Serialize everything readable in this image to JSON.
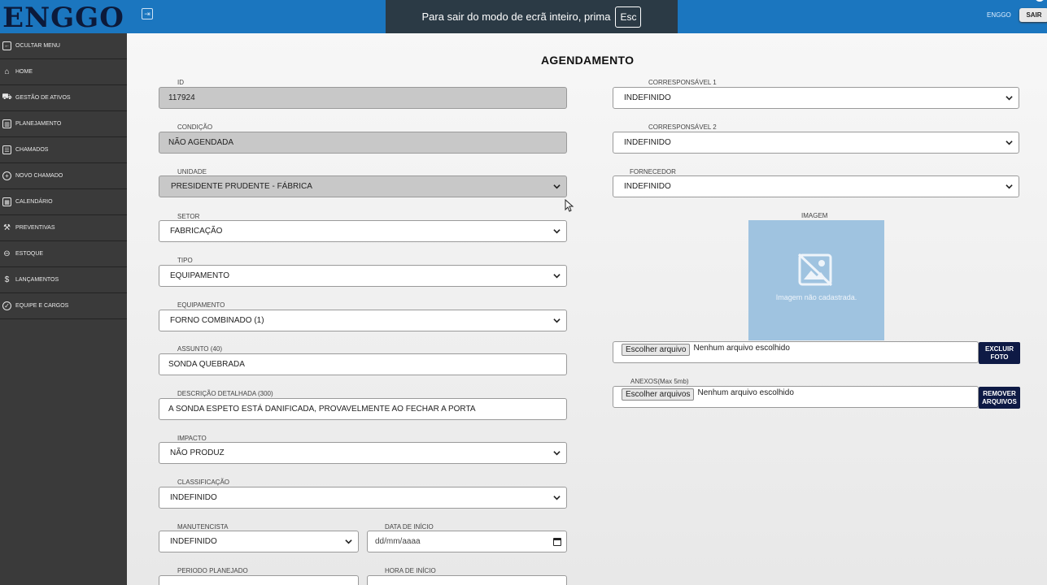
{
  "header": {
    "logo": "ENGGO",
    "fullscreen_banner": {
      "text": "Para sair do modo de ecrã inteiro, prima",
      "key": "Esc"
    },
    "user": "ENGGO",
    "logout_label": "SAIR"
  },
  "sidebar": {
    "items": [
      {
        "label": "OCULTAR MENU",
        "icon": "collapse-icon"
      },
      {
        "label": "HOME",
        "icon": "home-icon"
      },
      {
        "label": "GESTÃO DE ATIVOS",
        "icon": "truck-icon"
      },
      {
        "label": "PLANEJAMENTO",
        "icon": "columns-icon"
      },
      {
        "label": "CHAMADOS",
        "icon": "list-icon"
      },
      {
        "label": "NOVO CHAMADO",
        "icon": "plus-circle-icon"
      },
      {
        "label": "CALENDÁRIO",
        "icon": "calendar-icon"
      },
      {
        "label": "PREVENTIVAS",
        "icon": "tools-icon"
      },
      {
        "label": "ESTOQUE",
        "icon": "basket-icon"
      },
      {
        "label": "LANÇAMENTOS",
        "icon": "dollar-icon"
      },
      {
        "label": "EQUIPE E CARGOS",
        "icon": "shield-icon"
      }
    ]
  },
  "form": {
    "title": "AGENDAMENTO",
    "id": {
      "label": "ID",
      "value": "117924"
    },
    "condicao": {
      "label": "CONDIÇÃO",
      "value": "NÃO AGENDADA"
    },
    "unidade": {
      "label": "UNIDADE",
      "value": "PRESIDENTE PRUDENTE - FÁBRICA"
    },
    "setor": {
      "label": "SETOR",
      "value": "FABRICAÇÃO"
    },
    "tipo": {
      "label": "TIPO",
      "value": "EQUIPAMENTO"
    },
    "equipamento": {
      "label": "EQUIPAMENTO",
      "value": "FORNO COMBINADO (1)"
    },
    "assunto": {
      "label": "ASSUNTO (40)",
      "value": "SONDA QUEBRADA"
    },
    "descricao": {
      "label": "DESCRIÇÃO DETALHADA (300)",
      "value": "A SONDA ESPETO ESTÁ DANIFICADA, PROVAVELMENTE AO FECHAR A PORTA"
    },
    "impacto": {
      "label": "IMPACTO",
      "value": "NÃO PRODUZ"
    },
    "classificacao": {
      "label": "CLASSIFICAÇÃO",
      "value": "INDEFINIDO"
    },
    "manutencista": {
      "label": "MANUTENCISTA",
      "value": "INDEFINIDO"
    },
    "data_inicio": {
      "label": "DATA DE INÍCIO",
      "placeholder": "dd/mm/aaaa"
    },
    "periodo_planejado": {
      "label": "PERIODO PLANEJADO",
      "value": ""
    },
    "hora_inicio": {
      "label": "HORA DE INÍCIO",
      "value": ""
    },
    "corresponsavel1": {
      "label": "CORRESPONSÁVEL 1",
      "value": "INDEFINIDO"
    },
    "corresponsavel2": {
      "label": "CORRESPONSÁVEL 2",
      "value": "INDEFINIDO"
    },
    "fornecedor": {
      "label": "FORNECEDOR",
      "value": "INDEFINIDO"
    },
    "imagem": {
      "label": "IMAGEM",
      "placeholder_text": "Imagem não cadastrada."
    },
    "image_file": {
      "button": "Escolher arquivo",
      "status": "Nenhum arquivo escolhido",
      "delete_label": "EXCLUIR FOTO"
    },
    "anexos": {
      "label": "ANEXOS(Max 5mb)",
      "button": "Escolher arquivos",
      "status": "Nenhum arquivo escolhido",
      "remove_label": "REMOVER ARQUIVOS"
    }
  },
  "colors": {
    "topbar": "#1b76bf",
    "sidebar": "#3a3a3a",
    "dark_button": "#0e1a45",
    "image_placeholder": "#9fc3e0"
  }
}
